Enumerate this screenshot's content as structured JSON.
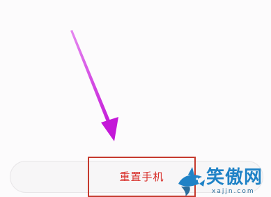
{
  "reset_phone": {
    "label": "重置手机"
  },
  "annotation": {
    "arrow_color": "#d726e6",
    "highlight_color": "#c53a2e"
  },
  "watermark": {
    "text": "笑傲网",
    "domain": "xajjn.com"
  },
  "colors": {
    "label": "#d8312c",
    "watermark": "#1f82c6"
  }
}
